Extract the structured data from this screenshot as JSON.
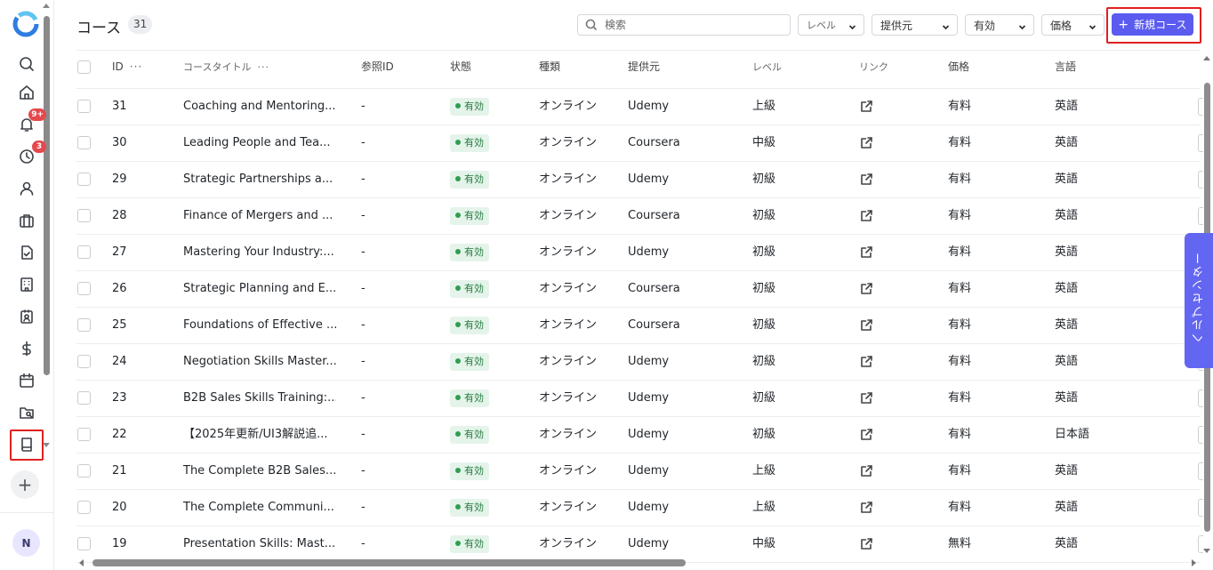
{
  "header": {
    "title": "コース",
    "count": "31",
    "search_placeholder": "検索",
    "filters": [
      {
        "label": "レベル"
      },
      {
        "label": "提供元"
      },
      {
        "label": "有効"
      },
      {
        "label": "価格"
      }
    ],
    "new_button_label": "新規コース"
  },
  "sidebar": {
    "notification_badge": "9+",
    "activity_badge": "3",
    "avatar_initial": "N",
    "icons": [
      "search-icon",
      "home-icon",
      "bell-icon",
      "clock-icon",
      "user-icon",
      "briefcase-icon",
      "document-icon",
      "building-icon",
      "badge-icon",
      "dollar-icon",
      "calendar-icon",
      "folder-search-icon",
      "book-icon",
      "plus-icon"
    ]
  },
  "table": {
    "columns": [
      "ID",
      "コースタイトル",
      "参照ID",
      "状態",
      "種類",
      "提供元",
      "レベル",
      "リンク",
      "価格",
      "言語"
    ],
    "rows": [
      {
        "id": "31",
        "title": "Coaching and Mentoring...",
        "ref": "-",
        "status": "有効",
        "type": "オンライン",
        "provider": "Udemy",
        "level": "上級",
        "price": "有料",
        "lang": "英語"
      },
      {
        "id": "30",
        "title": "Leading People and Tea...",
        "ref": "-",
        "status": "有効",
        "type": "オンライン",
        "provider": "Coursera",
        "level": "中級",
        "price": "有料",
        "lang": "英語"
      },
      {
        "id": "29",
        "title": "Strategic Partnerships a...",
        "ref": "-",
        "status": "有効",
        "type": "オンライン",
        "provider": "Udemy",
        "level": "初級",
        "price": "有料",
        "lang": "英語"
      },
      {
        "id": "28",
        "title": "Finance of Mergers and ...",
        "ref": "-",
        "status": "有効",
        "type": "オンライン",
        "provider": "Coursera",
        "level": "初級",
        "price": "有料",
        "lang": "英語"
      },
      {
        "id": "27",
        "title": "Mastering Your Industry:...",
        "ref": "-",
        "status": "有効",
        "type": "オンライン",
        "provider": "Udemy",
        "level": "初級",
        "price": "有料",
        "lang": "英語"
      },
      {
        "id": "26",
        "title": "Strategic Planning and E...",
        "ref": "-",
        "status": "有効",
        "type": "オンライン",
        "provider": "Coursera",
        "level": "初級",
        "price": "有料",
        "lang": "英語"
      },
      {
        "id": "25",
        "title": "Foundations of Effective ...",
        "ref": "-",
        "status": "有効",
        "type": "オンライン",
        "provider": "Coursera",
        "level": "初級",
        "price": "有料",
        "lang": "英語"
      },
      {
        "id": "24",
        "title": "Negotiation Skills Master...",
        "ref": "-",
        "status": "有効",
        "type": "オンライン",
        "provider": "Udemy",
        "level": "初級",
        "price": "有料",
        "lang": "英語"
      },
      {
        "id": "23",
        "title": "B2B Sales Skills Training:...",
        "ref": "-",
        "status": "有効",
        "type": "オンライン",
        "provider": "Udemy",
        "level": "初級",
        "price": "有料",
        "lang": "英語"
      },
      {
        "id": "22",
        "title": "【2025年更新/UI3解説追...",
        "ref": "-",
        "status": "有効",
        "type": "オンライン",
        "provider": "Udemy",
        "level": "初級",
        "price": "有料",
        "lang": "日本語"
      },
      {
        "id": "21",
        "title": "The Complete B2B Sales...",
        "ref": "-",
        "status": "有効",
        "type": "オンライン",
        "provider": "Udemy",
        "level": "上級",
        "price": "有料",
        "lang": "英語"
      },
      {
        "id": "20",
        "title": "The Complete Communi...",
        "ref": "-",
        "status": "有効",
        "type": "オンライン",
        "provider": "Udemy",
        "level": "上級",
        "price": "有料",
        "lang": "英語"
      },
      {
        "id": "19",
        "title": "Presentation Skills: Mast...",
        "ref": "-",
        "status": "有効",
        "type": "オンライン",
        "provider": "Udemy",
        "level": "中級",
        "price": "無料",
        "lang": "英語"
      }
    ]
  },
  "help": {
    "label": "ヘルプセンター"
  },
  "colors": {
    "accent": "#5b5bf0",
    "status_bg": "#e5f4ea",
    "status_text": "#247a3f",
    "badge": "#e5484d"
  }
}
